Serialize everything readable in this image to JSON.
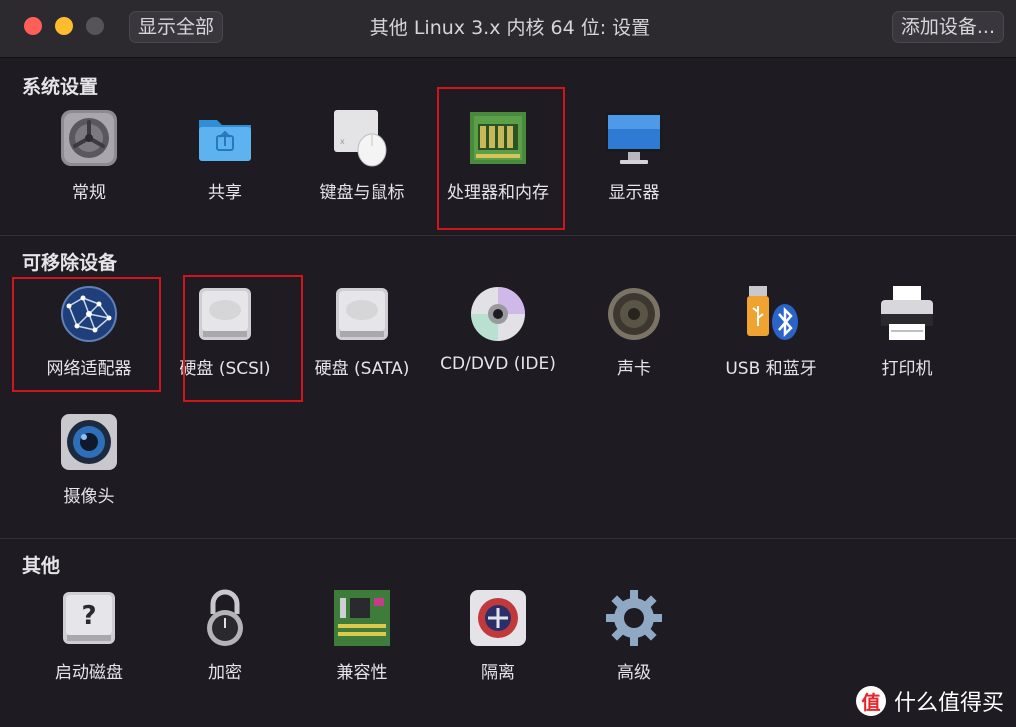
{
  "window": {
    "title": "其他 Linux 3.x 内核 64 位: 设置",
    "show_all_label": "显示全部",
    "add_device_label": "添加设备..."
  },
  "sections": [
    {
      "title": "系统设置",
      "items": [
        {
          "label": "常规",
          "icon": "gear-switch-icon"
        },
        {
          "label": "共享",
          "icon": "shared-folder-icon"
        },
        {
          "label": "键盘与鼠标",
          "icon": "keyboard-mouse-icon"
        },
        {
          "label": "处理器和内存",
          "icon": "memory-chip-icon"
        },
        {
          "label": "显示器",
          "icon": "monitor-icon"
        }
      ]
    },
    {
      "title": "可移除设备",
      "items": [
        {
          "label": "网络适配器",
          "icon": "network-globe-icon"
        },
        {
          "label": "硬盘 (SCSI)",
          "icon": "hard-disk-icon"
        },
        {
          "label": "硬盘 (SATA)",
          "icon": "hard-disk-icon"
        },
        {
          "label": "CD/DVD (IDE)",
          "icon": "cd-dvd-icon"
        },
        {
          "label": "声卡",
          "icon": "speaker-icon"
        },
        {
          "label": "USB 和蓝牙",
          "icon": "usb-bluetooth-icon"
        },
        {
          "label": "打印机",
          "icon": "printer-icon"
        },
        {
          "label": "摄像头",
          "icon": "camera-icon"
        }
      ]
    },
    {
      "title": "其他",
      "items": [
        {
          "label": "启动磁盘",
          "icon": "startup-disk-icon"
        },
        {
          "label": "加密",
          "icon": "padlock-icon"
        },
        {
          "label": "兼容性",
          "icon": "circuit-board-icon"
        },
        {
          "label": "隔离",
          "icon": "isolation-icon"
        },
        {
          "label": "高级",
          "icon": "gear-icon"
        }
      ]
    }
  ],
  "watermark": {
    "text": "什么值得买",
    "logo_char": "值"
  },
  "colors": {
    "highlight": "#d0161b",
    "background": "#1e1b22"
  }
}
